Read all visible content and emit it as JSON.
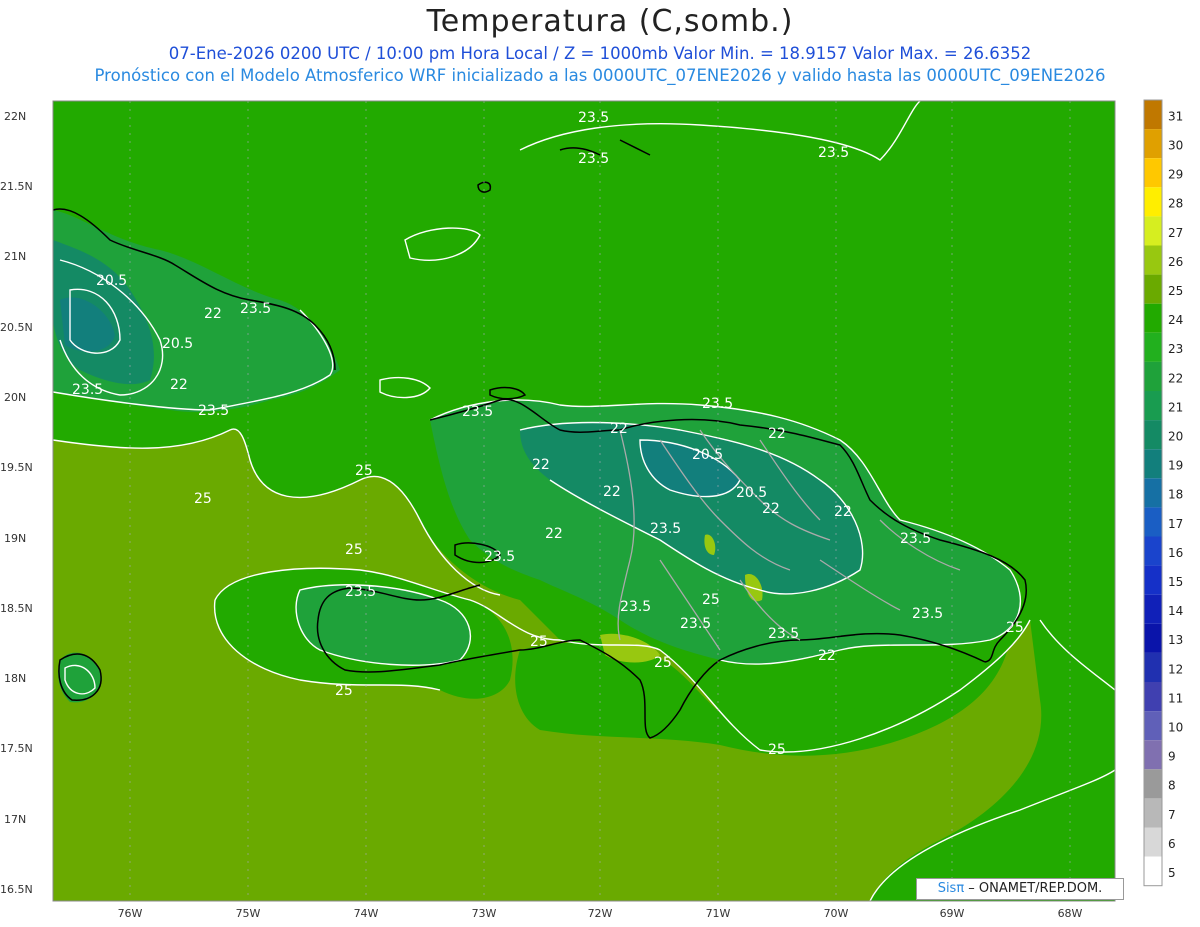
{
  "header": {
    "title": "Temperatura (C,somb.)",
    "line1": "07-Ene-2026 0200 UTC / 10:00 pm Hora Local / Z = 1000mb  Valor Min. = 18.9157  Valor Max. = 26.6352",
    "line2": "Pronóstico con el Modelo Atmosferico WRF inicializado a las 0000UTC_07ENE2026 y valido hasta las  0000UTC_09ENE2026"
  },
  "axes": {
    "lat_labels": [
      "22N",
      "21.5N",
      "21N",
      "20.5N",
      "20N",
      "19.5N",
      "19N",
      "18.5N",
      "18N",
      "17.5N",
      "17N",
      "16.5N"
    ],
    "lon_labels": [
      "76W",
      "75W",
      "74W",
      "73W",
      "72W",
      "71W",
      "70W",
      "69W",
      "68W"
    ]
  },
  "contour_labels": [
    "23.5",
    "23.5",
    "23.5",
    "20.5",
    "22",
    "23.5",
    "20.5",
    "23.5",
    "22",
    "23.5",
    "25",
    "25",
    "25",
    "25",
    "23.5",
    "23.5",
    "22",
    "22",
    "20.5",
    "20.5",
    "22",
    "22",
    "22",
    "23.5",
    "23.5",
    "22",
    "23.5",
    "23.5",
    "23.5",
    "23.5",
    "22",
    "23.5",
    "25",
    "25",
    "25",
    "25",
    "25",
    "22",
    "23.5"
  ],
  "colorbar": {
    "labels": [
      "31",
      "30",
      "29",
      "28",
      "27",
      "26",
      "25",
      "24",
      "23",
      "22",
      "21",
      "20",
      "19",
      "18",
      "17",
      "16",
      "15",
      "14",
      "13",
      "12",
      "11",
      "10",
      "9",
      "8",
      "7",
      "6",
      "5"
    ],
    "colors": [
      "#c07800",
      "#e0a000",
      "#ffc800",
      "#ffee00",
      "#d6ee20",
      "#98c810",
      "#6aaa00",
      "#22aa00",
      "#22b01e",
      "#1fa23a",
      "#199c50",
      "#148a64",
      "#127f7c",
      "#1670a4",
      "#1a5ec4",
      "#1a44cc",
      "#1530c8",
      "#1020b8",
      "#0a14aa",
      "#2030b0",
      "#4040b0",
      "#6060b8",
      "#8070b0",
      "#9a9a9a",
      "#b8b8b8",
      "#d8d8d8",
      "#ffffff"
    ]
  },
  "field_colors": {
    "land_level": "#22aa00",
    "sea_25": "#6aaa00",
    "cool_22": "#1fa23a",
    "cool_20": "#148a64",
    "warm_26": "#98c810"
  },
  "credit": {
    "sis": "Sis",
    "pi": "π",
    "rest": " – ONAMET/REP.DOM."
  }
}
